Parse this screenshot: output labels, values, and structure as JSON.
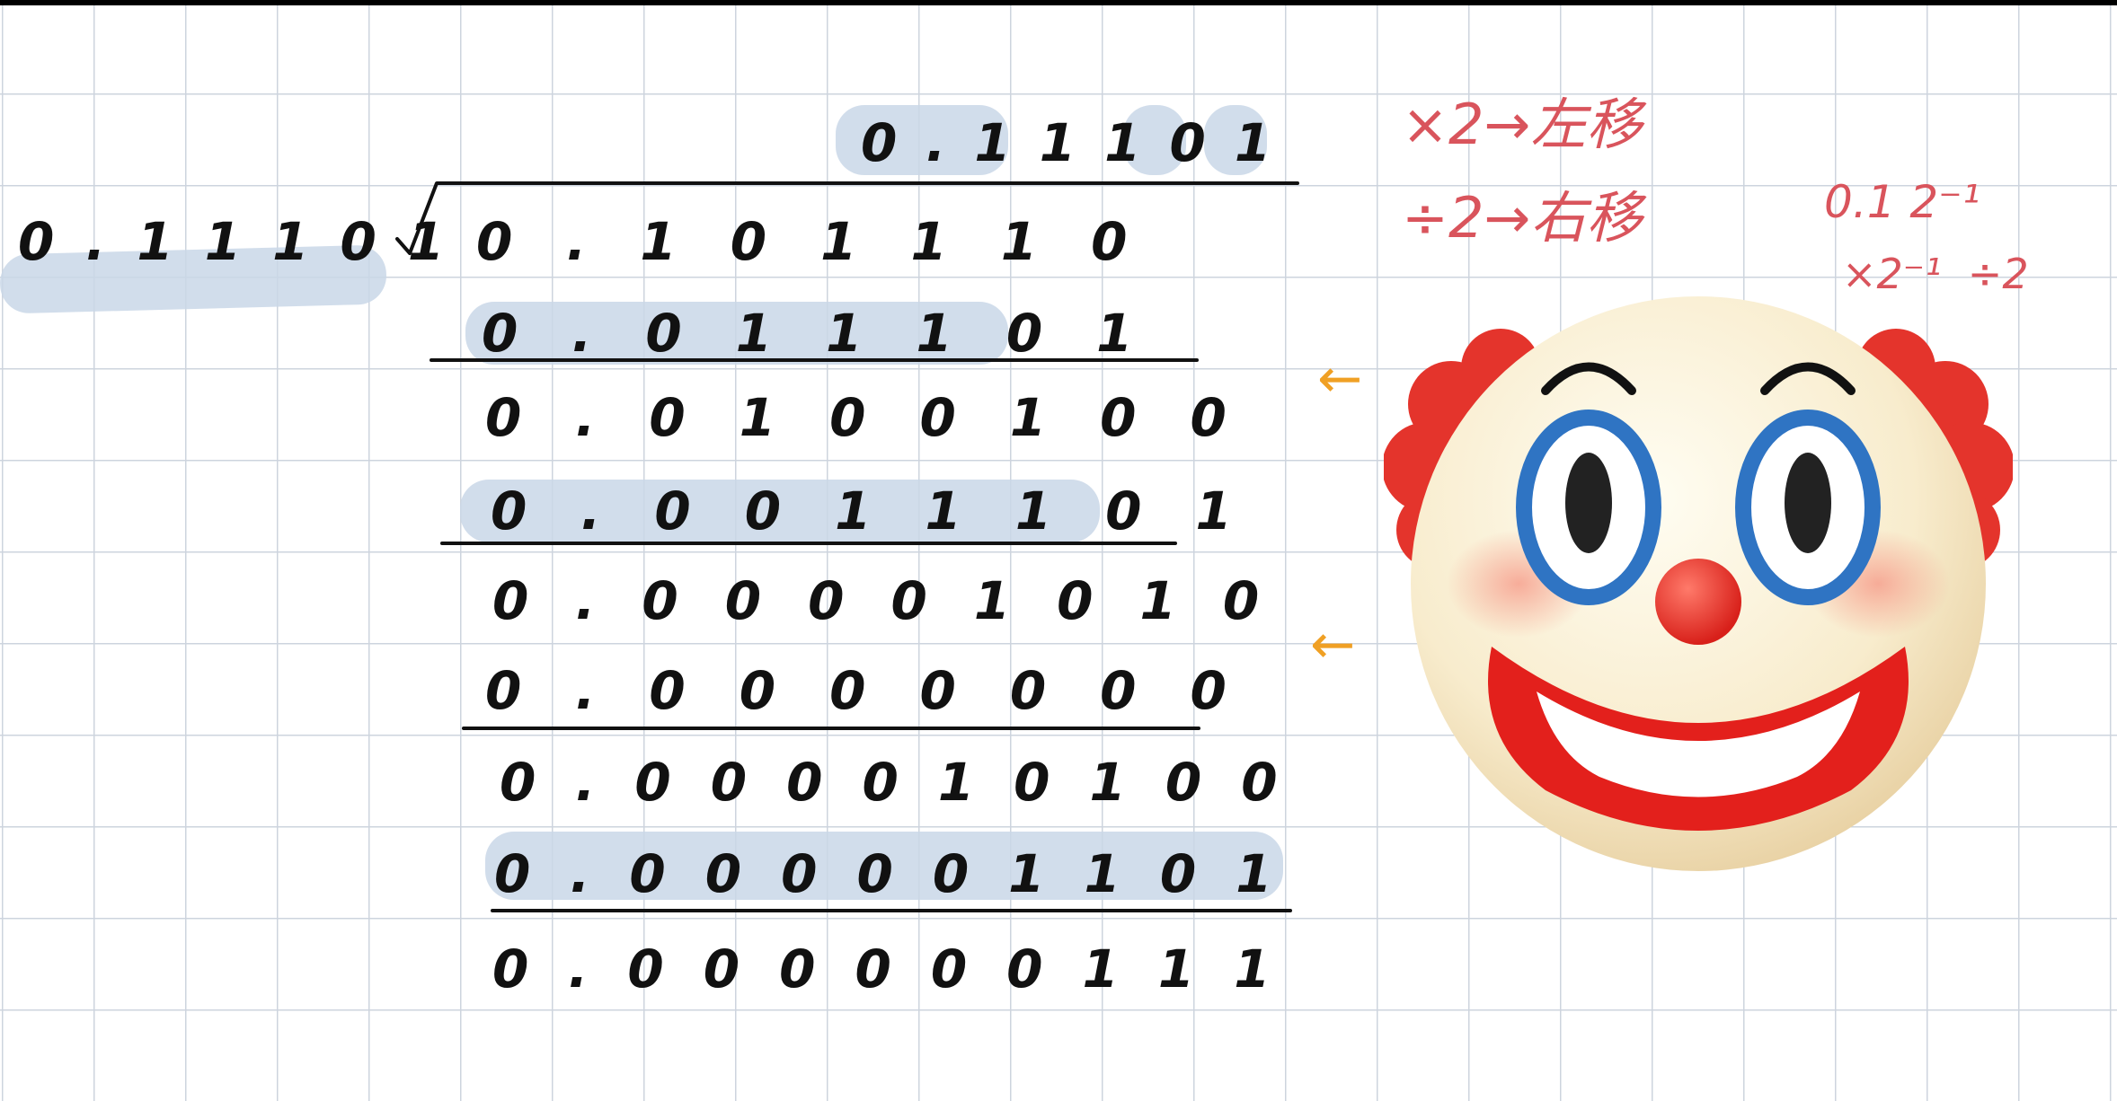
{
  "divisor": "0.11101",
  "quotient": "0.11101",
  "steps": [
    "0.101110",
    "0.011101",
    "0.0100100",
    "0.0011101",
    "0.00001010",
    "0.0000000",
    "0.000010100",
    "0.000001101",
    "0.000000111"
  ],
  "notes": {
    "shift_left": "×2→左移",
    "shift_right": "÷2→右移",
    "small": "0.1 2⁻¹",
    "small_ops": "×2⁻¹  ÷2"
  },
  "arrow_glyph": "←",
  "sticker_icon": "clown-face-icon",
  "colors": {
    "grid": "#cdd4de",
    "highlight": "#c9d7e8",
    "ink": "#111111",
    "note": "#d9545c",
    "arrow": "#f0a024"
  }
}
